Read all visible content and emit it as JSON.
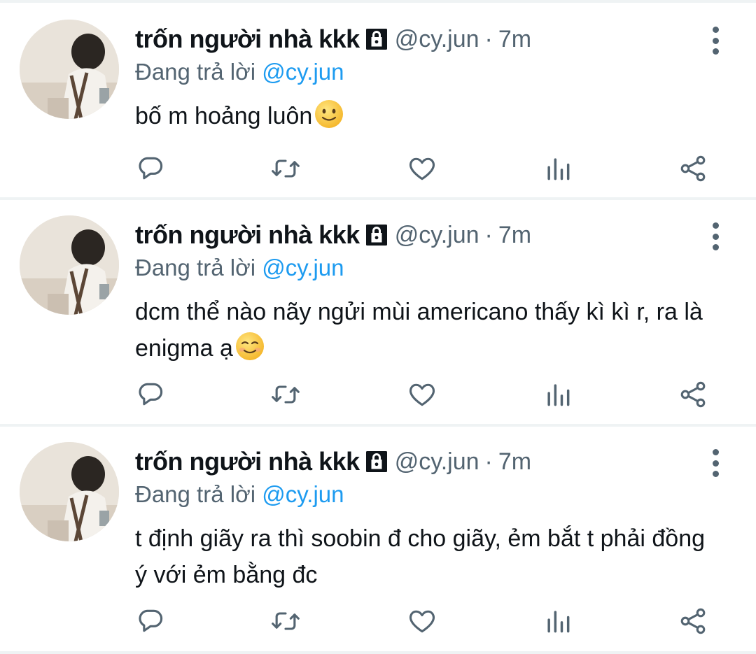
{
  "tweets": [
    {
      "name": "trốn người nhà kkk",
      "handle": "@cy.jun",
      "separator": "·",
      "time": "7m",
      "reply_prefix": "Đang trả lời",
      "reply_to": "@cy.jun",
      "text": "bố m hoảng luôn",
      "emoji": "slightly-smiling-face"
    },
    {
      "name": "trốn người nhà kkk",
      "handle": "@cy.jun",
      "separator": "·",
      "time": "7m",
      "reply_prefix": "Đang trả lời",
      "reply_to": "@cy.jun",
      "text": "dcm thể nào nãy ngửi mùi americano thấy kì kì r, ra là enigma ạ",
      "emoji": "smiling-face-blush"
    },
    {
      "name": "trốn người nhà kkk",
      "handle": "@cy.jun",
      "separator": "·",
      "time": "7m",
      "reply_prefix": "Đang trả lời",
      "reply_to": "@cy.jun",
      "text": "t định giãy ra thì soobin đ cho giãy, ẻm bắt t phải đồng ý với ẻm bằng đc",
      "emoji": ""
    }
  ],
  "icons": {
    "protected": "lock-icon",
    "more": "more-vertical-icon",
    "reply": "reply-icon",
    "retweet": "retweet-icon",
    "like": "heart-icon",
    "views": "views-icon",
    "share": "share-icon"
  },
  "colors": {
    "text_primary": "#0f1419",
    "text_secondary": "#536471",
    "accent": "#1d9bf0",
    "divider": "#eff3f4"
  }
}
